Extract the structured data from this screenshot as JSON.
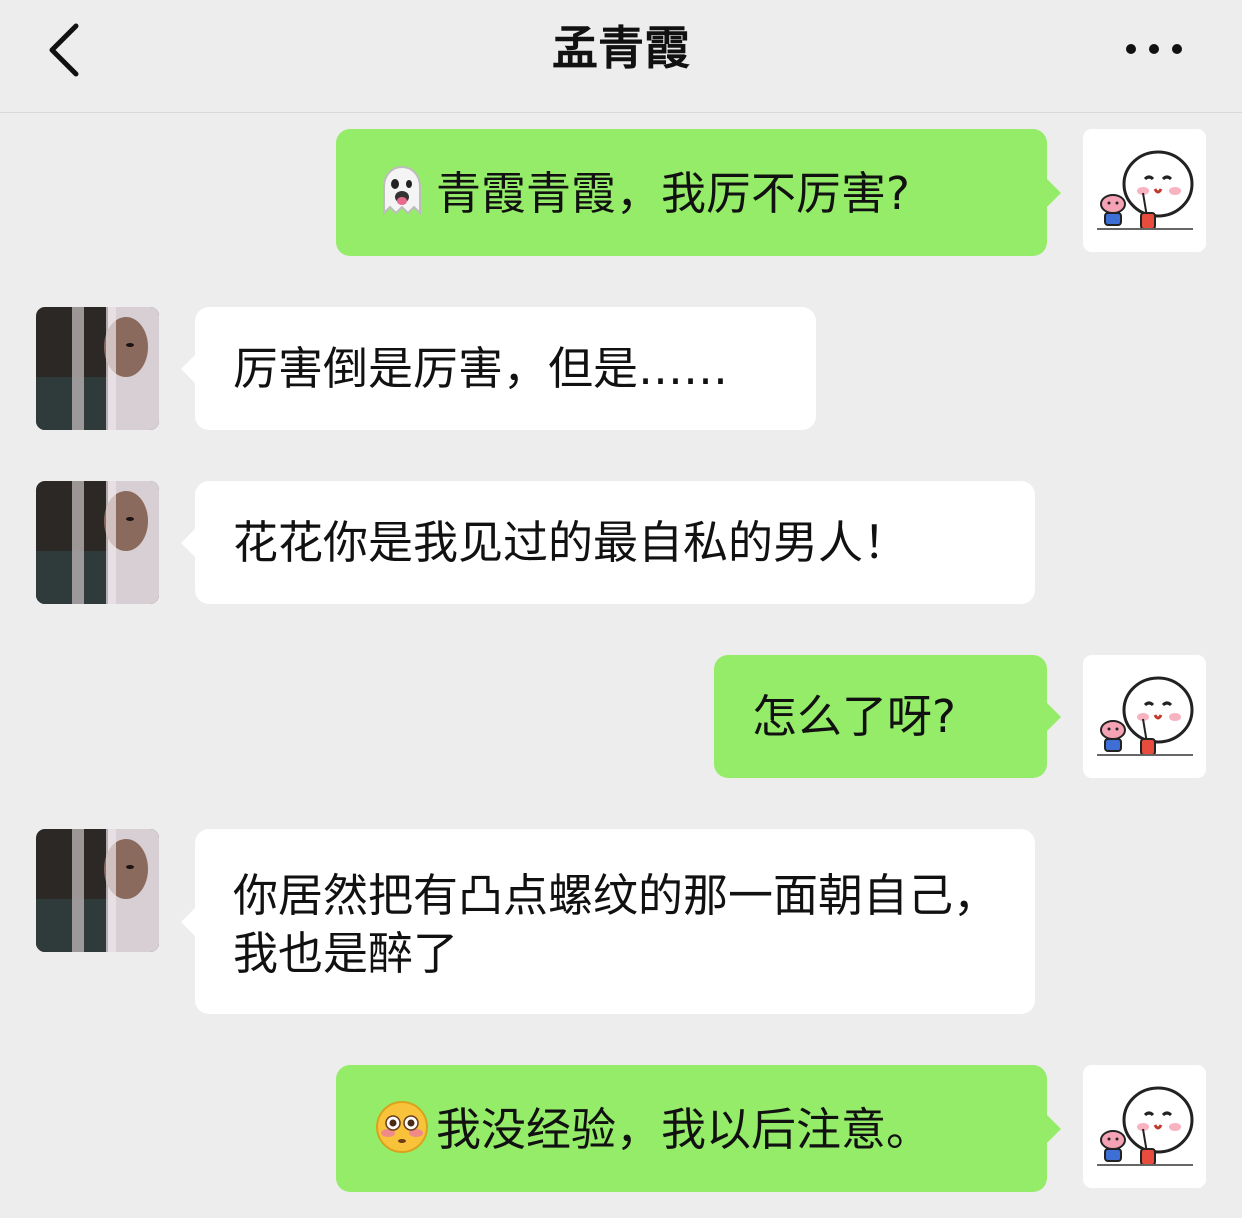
{
  "header": {
    "title": "孟青霞"
  },
  "messages": [
    {
      "side": "self",
      "emoji": "ghost-tongue",
      "text": "青霞青霞，我厉不厉害?"
    },
    {
      "side": "other",
      "text": "厉害倒是厉害，但是……"
    },
    {
      "side": "other",
      "text": "花花你是我见过的最自私的男人！"
    },
    {
      "side": "self",
      "text": "怎么了呀?"
    },
    {
      "side": "other",
      "text": "你居然把有凸点螺纹的那一面朝自己，我也是醉了"
    },
    {
      "side": "self",
      "emoji": "flushed-face",
      "text": "我没经验，我以后注意。"
    }
  ],
  "colors": {
    "background": "#ededed",
    "self_bubble": "#95ec69",
    "other_bubble": "#ffffff",
    "text": "#111111"
  }
}
